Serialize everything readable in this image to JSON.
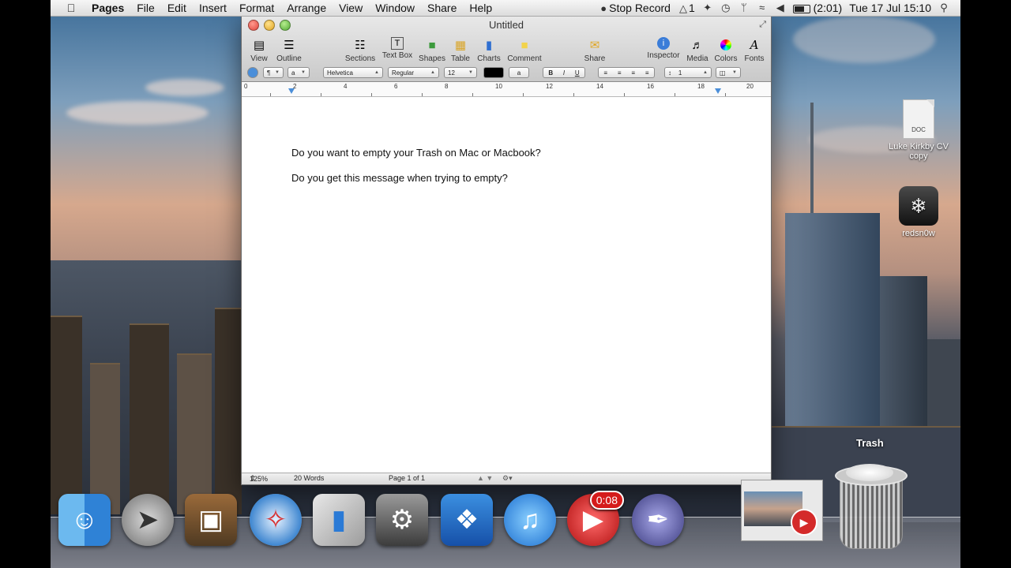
{
  "menubar": {
    "apple": "",
    "items": [
      "Pages",
      "File",
      "Edit",
      "Insert",
      "Format",
      "Arrange",
      "View",
      "Window",
      "Share",
      "Help"
    ],
    "stop_record": "Stop Record",
    "adobe_count": "1",
    "battery": "(2:01)",
    "datetime": "Tue 17 Jul  15:10"
  },
  "window": {
    "title": "Untitled",
    "toolbar": [
      {
        "label": "View",
        "icon": "view-icon"
      },
      {
        "label": "Outline",
        "icon": "outline-icon"
      },
      {
        "label": "Sections",
        "icon": "sections-icon"
      },
      {
        "label": "Text Box",
        "icon": "text-box-icon"
      },
      {
        "label": "Shapes",
        "icon": "shapes-icon"
      },
      {
        "label": "Table",
        "icon": "table-icon"
      },
      {
        "label": "Charts",
        "icon": "charts-icon"
      },
      {
        "label": "Comment",
        "icon": "comment-icon"
      },
      {
        "label": "Share",
        "icon": "share-icon"
      },
      {
        "label": "Inspector",
        "icon": "inspector-icon"
      },
      {
        "label": "Media",
        "icon": "media-icon"
      },
      {
        "label": "Colors",
        "icon": "colors-icon"
      },
      {
        "label": "Fonts",
        "icon": "fonts-icon"
      }
    ],
    "format_bar": {
      "style": "a",
      "font": "Helvetica",
      "typeface": "Regular",
      "size": "12",
      "text_color": "#000000",
      "spacing": "1",
      "bold": "B",
      "italic": "I",
      "underline": "U"
    },
    "ruler_numbers": [
      "0",
      "2",
      "4",
      "6",
      "8",
      "10",
      "12",
      "14",
      "16",
      "18",
      "20"
    ],
    "paragraphs": [
      "Do you want to empty your Trash on Mac or Macbook?",
      "Do you get this message when trying to empty?"
    ],
    "status": {
      "zoom": "125%",
      "words": "20 Words",
      "page": "Page 1 of 1"
    }
  },
  "desktop": {
    "icons": [
      {
        "label": "Luke Kirkby CV copy",
        "badge": "DOC"
      },
      {
        "label": "redsn0w"
      }
    ],
    "trash_label": "Trash"
  },
  "dock": {
    "apps": [
      "Finder",
      "Launchpad",
      "Preview",
      "Safari",
      "Numbers",
      "System Preferences",
      "Vuze",
      "iTunes",
      "Screen Recorder",
      "Script Editor"
    ],
    "recorder_badge": "0:08"
  }
}
